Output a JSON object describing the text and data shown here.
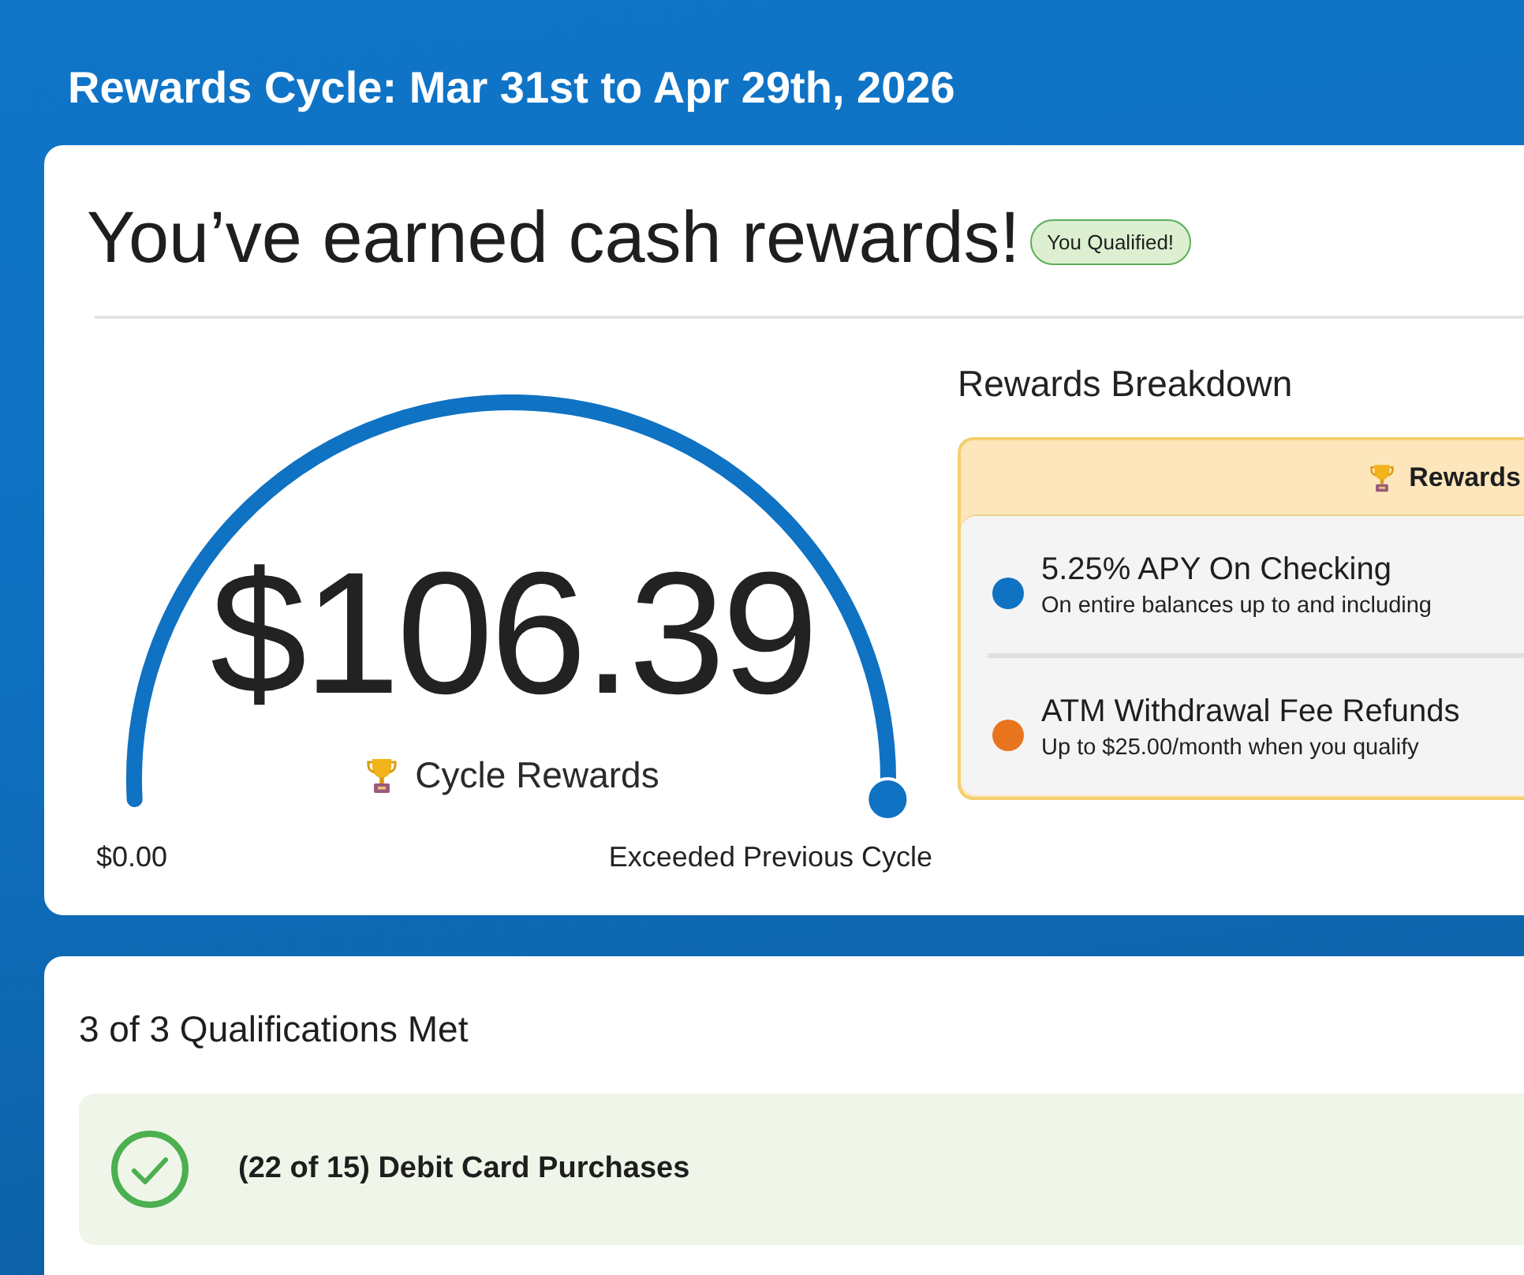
{
  "header": {
    "title": "Rewards Cycle: Mar 31st to Apr 29th, 2026"
  },
  "summary_card": {
    "title": "You’ve earned cash rewards!",
    "badge": "You Qualified!",
    "gauge": {
      "amount": "$106.39",
      "label": "Cycle Rewards",
      "level": 1,
      "min_label": "$0.00",
      "status_label": "Exceeded Previous Cycle"
    },
    "breakdown": {
      "title": "Rewards Breakdown",
      "header": "Rewards",
      "items": [
        {
          "title": "5.25% APY On Checking",
          "description": "On entire balances up to and including",
          "color": "#0f72c3"
        },
        {
          "title": "ATM Withdrawal Fee Refunds",
          "description": "Up to $25.00/month when you qualify",
          "color": "#e8741e"
        }
      ]
    }
  },
  "qualifications_card": {
    "title": "3 of 3 Qualifications Met",
    "items": [
      {
        "label": "(22 of 15) Debit Card Purchases",
        "met": true
      }
    ]
  }
}
